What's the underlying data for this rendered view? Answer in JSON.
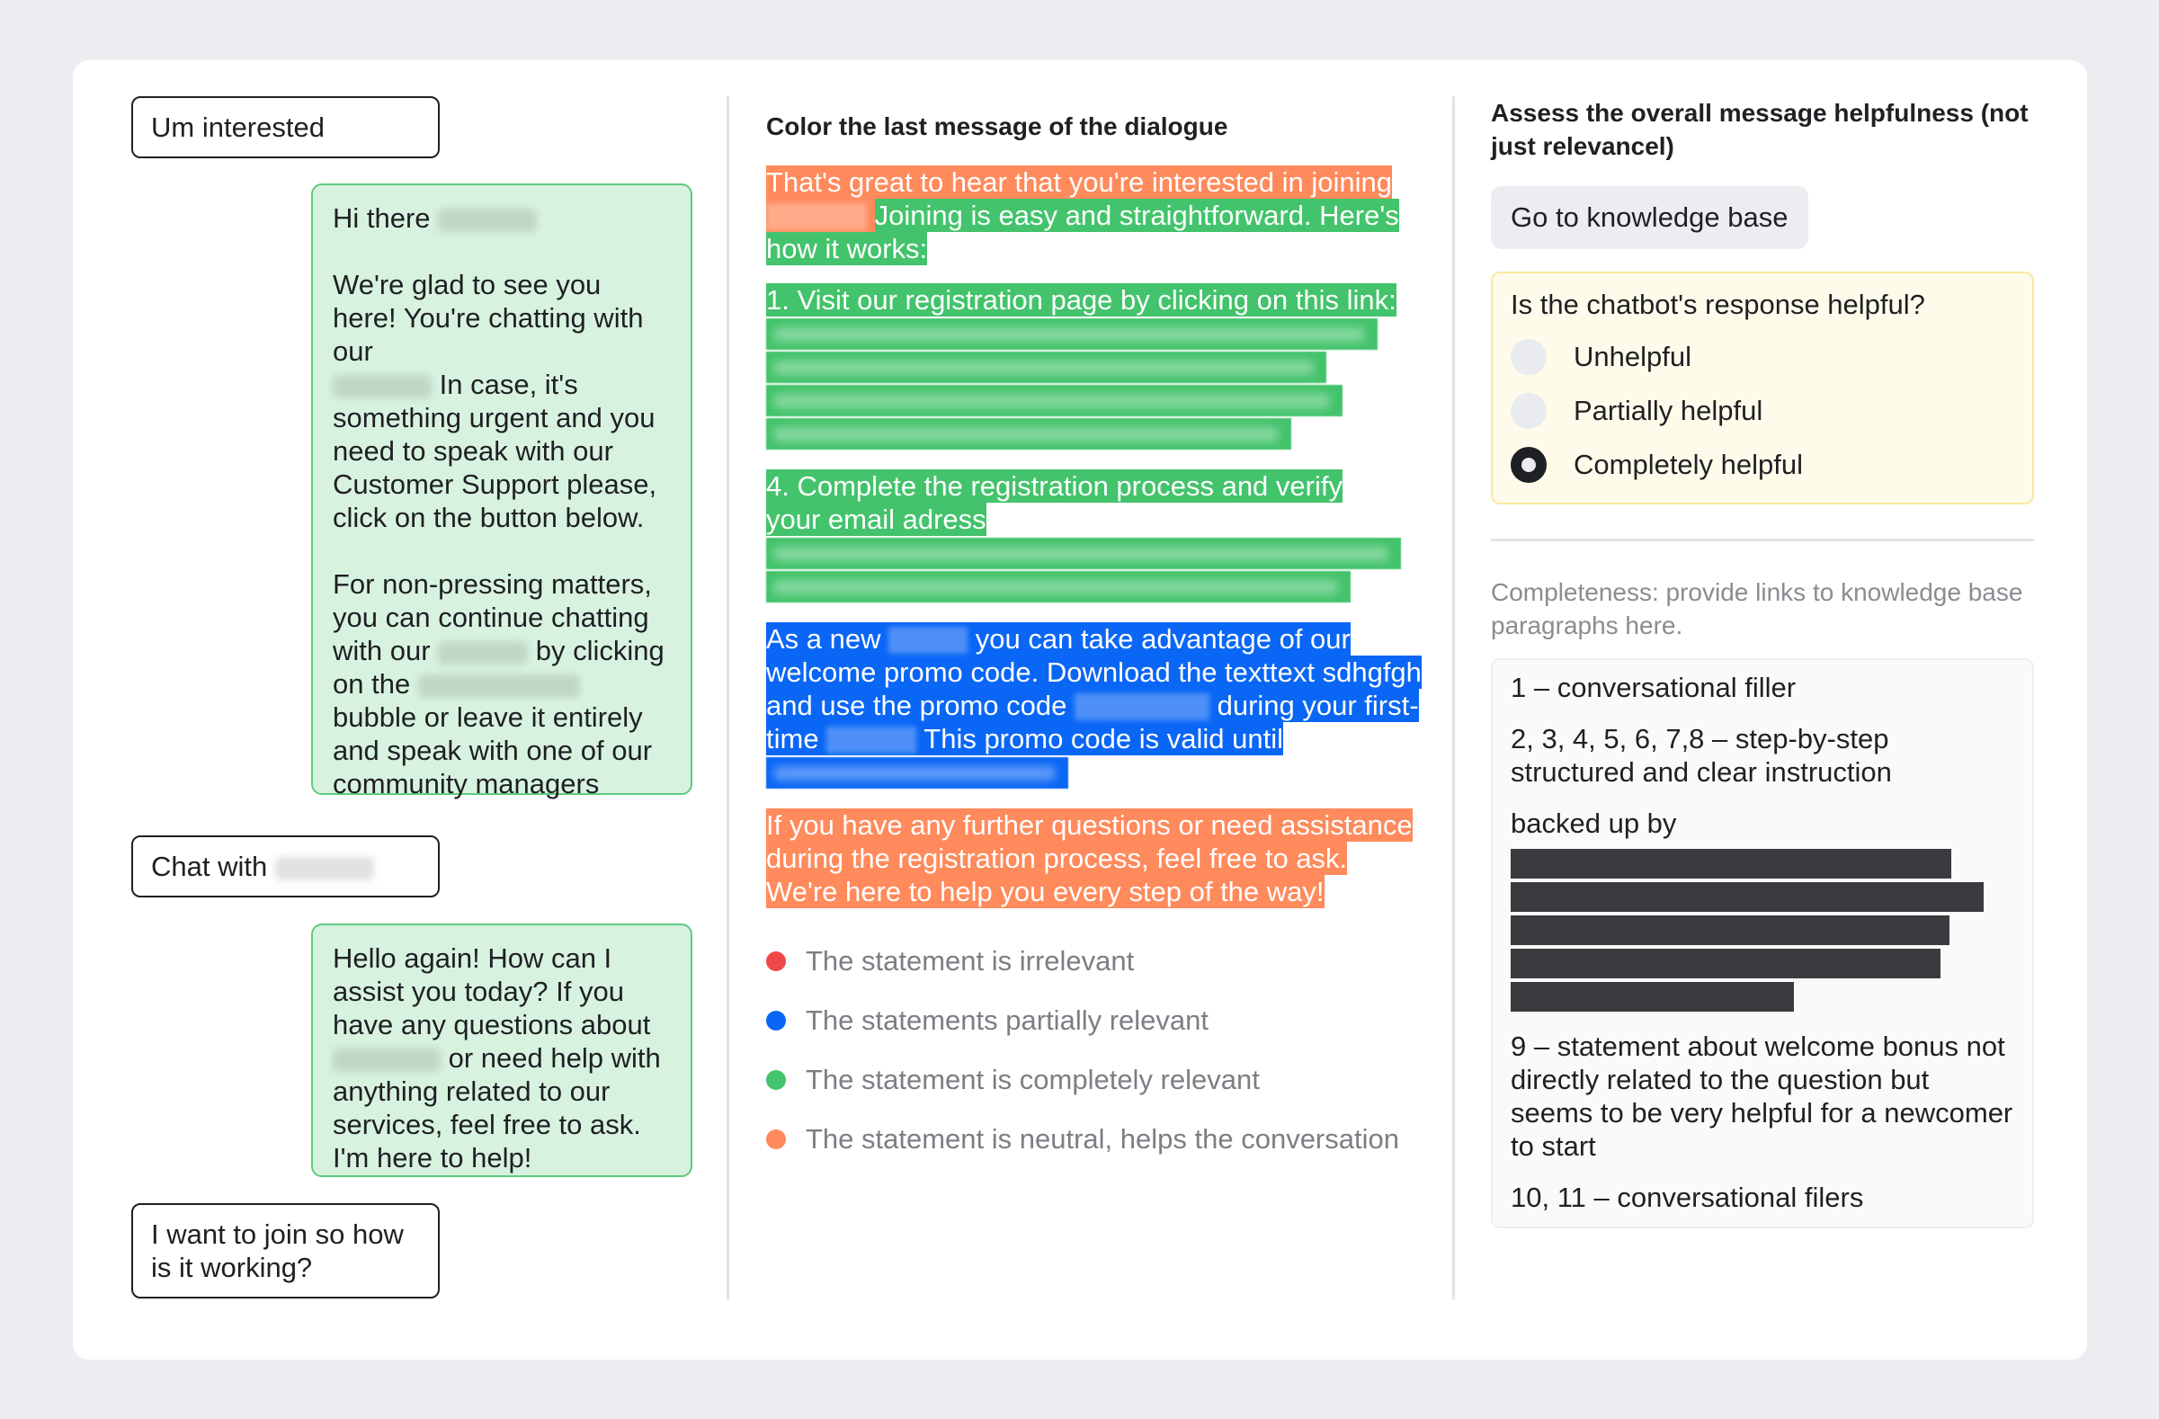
{
  "dialog": {
    "messages": [
      {
        "role": "user",
        "text": "Um interested"
      },
      {
        "role": "bot",
        "paragraphs": [
          {
            "before": "Hi there",
            "redacted": true,
            "after": ""
          },
          {
            "text_lines": "We're glad to see you here! You're chatting with our",
            "redacted": true,
            "after": "In case, it's something urgent and you need to speak with our Customer Support please, click on the button below."
          },
          {
            "p3_a": "For non-pressing matters, you can continue chatting with our",
            "p3_b": "by clicking on the",
            "p3_c": "bubble or leave it entirely and speak with one of our community managers"
          }
        ]
      },
      {
        "role": "user",
        "text": "Chat with",
        "redacted_suffix": true
      },
      {
        "role": "bot",
        "a": "Hello again! How can I assist you today? If you have any questions about",
        "b": "or need help with anything related to our services, feel free to ask. I'm here to help!"
      },
      {
        "role": "user",
        "text": "I want to join so how is it working?"
      }
    ]
  },
  "annotation": {
    "title": "Color the last message of the dialogue",
    "segments": {
      "s1": "That's great to hear that you're interested in joining",
      "s2": "Joining is easy and straightforward. Here's how it works:",
      "s3": "1. Visit our registration page by clicking on this link:",
      "s4": "4. Complete the registration process and verify your email adress",
      "s5a": "As a new",
      "s5b": "you can take advantage of our welcome promo code. Download the texttext sdhgfgh and use the promo code",
      "s5c": "during your first-time",
      "s5d": "This promo code is valid until",
      "s6": "If you have any further questions or need assistance during the registration process, feel free to ask. We're here to help you every step of the way!"
    },
    "legend": [
      {
        "label": "The statement is irrelevant",
        "color": "#F04848"
      },
      {
        "label": "The statements partially relevant",
        "color": "#0A66F5"
      },
      {
        "label": "The statement is completely relevant",
        "color": "#43C36B"
      },
      {
        "label": "The statement is neutral, helps the conversation",
        "color": "#FF8A5C"
      }
    ],
    "colors": {
      "orange": "#FF8A5C",
      "green": "#43C36B",
      "blue": "#0A66F5"
    }
  },
  "assessment": {
    "title": "Assess the overall message helpfulness (not just relevancel)",
    "kb_button": "Go to knowledge base",
    "question": "Is the chatbot's response helpful?",
    "options": [
      {
        "label": "Unhelpful",
        "checked": false
      },
      {
        "label": "Partially helpful",
        "checked": false
      },
      {
        "label": "Completely helpful",
        "checked": true
      }
    ],
    "completeness_label": "Completeness: provide links to knowledge base paragraphs here.",
    "notes": {
      "n1": "1 – conversational filler",
      "n2": "2, 3, 4, 5, 6, 7,8 – step-by-step structured and clear instruction",
      "n3": "backed up by",
      "n4": "9 – statement about welcome bonus not directly related to the question but seems to be very helpful for a newcomer to start",
      "n5": "10, 11 – conversational filers"
    }
  }
}
